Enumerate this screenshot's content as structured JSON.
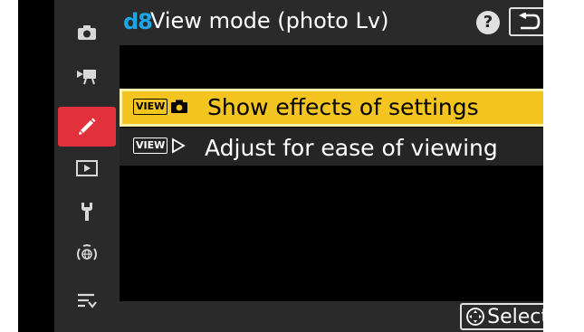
{
  "header": {
    "menu_code": "d8",
    "title": "View mode (photo Lv)",
    "help_label": "?"
  },
  "sidebar": {
    "tabs": [
      {
        "name": "photo-shooting-menu",
        "icon": "camera-icon",
        "active": false
      },
      {
        "name": "movie-recording-menu",
        "icon": "movie-camera-icon",
        "active": false
      },
      {
        "name": "custom-settings-menu",
        "icon": "pencil-icon",
        "active": true
      },
      {
        "name": "playback-menu",
        "icon": "playback-icon",
        "active": false
      },
      {
        "name": "setup-menu",
        "icon": "wrench-icon",
        "active": false
      },
      {
        "name": "network-menu",
        "icon": "network-icon",
        "active": false
      },
      {
        "name": "my-menu",
        "icon": "my-menu-icon",
        "active": false
      }
    ]
  },
  "options": [
    {
      "badge": "VIEW",
      "icon": "camera-icon",
      "label": "Show effects of settings",
      "selected": true
    },
    {
      "badge": "VIEW",
      "icon": "play-outline-icon",
      "label": "Adjust for ease of viewing",
      "selected": false
    }
  ],
  "footer": {
    "select_label": "Select"
  },
  "colors": {
    "selected_row": "#f4c420",
    "active_tab": "#e1313b",
    "menu_code": "#1ca5e8"
  }
}
